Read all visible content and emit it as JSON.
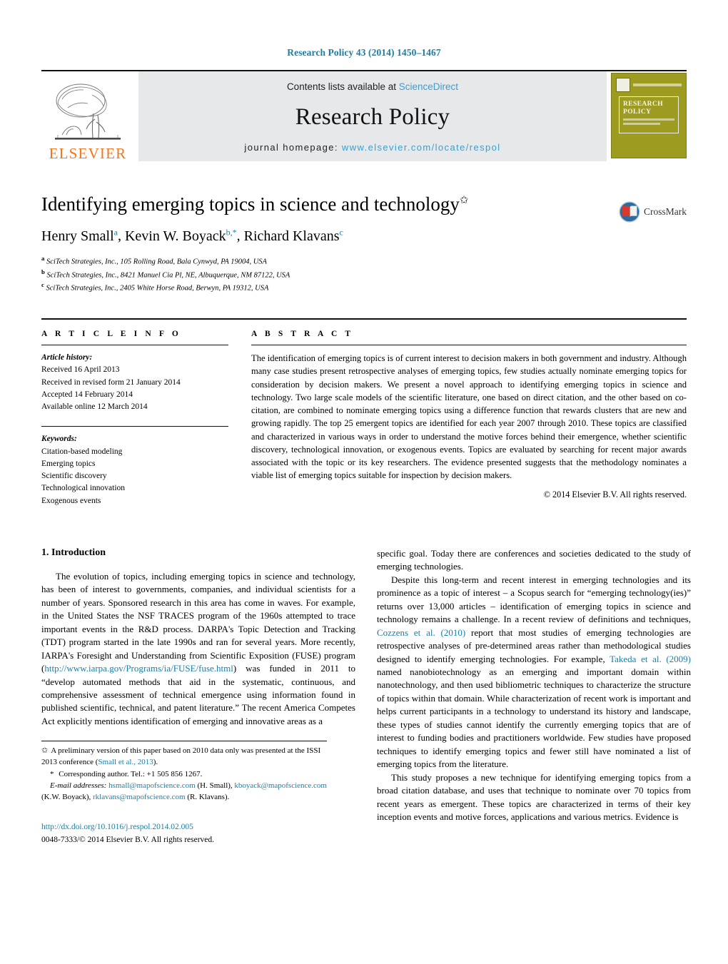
{
  "running_head": "Research Policy 43 (2014) 1450–1467",
  "masthead": {
    "contents_prefix": "Contents lists available at ",
    "sciencedirect": "ScienceDirect",
    "journal_name": "Research Policy",
    "homepage_prefix": "journal homepage: ",
    "homepage_url": "www.elsevier.com/locate/respol",
    "elsevier_wordmark": "ELSEVIER",
    "cover_title": "RESEARCH POLICY",
    "accent_link": "#3a9fd0",
    "elsevier_orange": "#F3761B",
    "cover_olive": "#9d9c21"
  },
  "article": {
    "title": "Identifying emerging topics in science and technology",
    "title_symbol": "✩",
    "authors": "Henry Small, Kevin W. Boyack, Richard Klavans",
    "author_list": [
      {
        "name": "Henry Small",
        "sup": "a"
      },
      {
        "name": "Kevin W. Boyack",
        "sup": "b,*"
      },
      {
        "name": "Richard Klavans",
        "sup": "c"
      }
    ],
    "affiliations": [
      {
        "sup": "a",
        "text": "SciTech Strategies, Inc., 105 Rolling Road, Bala Cynwyd, PA 19004, USA"
      },
      {
        "sup": "b",
        "text": "SciTech Strategies, Inc., 8421 Manuel Cia Pl, NE, Albuquerque, NM 87122, USA"
      },
      {
        "sup": "c",
        "text": "SciTech Strategies, Inc., 2405 White Horse Road, Berwyn, PA 19312, USA"
      }
    ],
    "crossmark_label": "CrossMark"
  },
  "info": {
    "heading": "A R T I C L E   I N F O",
    "history_label": "Article history:",
    "history": [
      "Received 16 April 2013",
      "Received in revised form 21 January 2014",
      "Accepted 14 February 2014",
      "Available online 12 March 2014"
    ],
    "keywords_label": "Keywords:",
    "keywords": [
      "Citation-based modeling",
      "Emerging topics",
      "Scientific discovery",
      "Technological innovation",
      "Exogenous events"
    ]
  },
  "abstract": {
    "heading": "A B S T R A C T",
    "text": "The identification of emerging topics is of current interest to decision makers in both government and industry. Although many case studies present retrospective analyses of emerging topics, few studies actually nominate emerging topics for consideration by decision makers. We present a novel approach to identifying emerging topics in science and technology. Two large scale models of the scientific literature, one based on direct citation, and the other based on co-citation, are combined to nominate emerging topics using a difference function that rewards clusters that are new and growing rapidly. The top 25 emergent topics are identified for each year 2007 through 2010. These topics are classified and characterized in various ways in order to understand the motive forces behind their emergence, whether scientific discovery, technological innovation, or exogenous events. Topics are evaluated by searching for recent major awards associated with the topic or its key researchers. The evidence presented suggests that the methodology nominates a viable list of emerging topics suitable for inspection by decision makers.",
    "copyright": "© 2014 Elsevier B.V. All rights reserved."
  },
  "body": {
    "section_number_title": "1.  Introduction",
    "left_para_1_a": "The evolution of topics, including emerging topics in science and technology, has been of interest to governments, companies, and individual scientists for a number of years. Sponsored research in this area has come in waves. For example, in the United States the NSF TRACES program of the 1960s attempted to trace important events in the R&D process. DARPA's Topic Detection and Tracking (TDT) program started in the late 1990s and ran for several years. More recently, IARPA's Foresight and Understanding from Scientific Exposition (FUSE) program (",
    "fuse_url": "http://www.iarpa.gov/Programs/ia/FUSE/fuse.html",
    "left_para_1_b": ") was funded in 2011 to “develop automated methods that aid in the systematic, continuous, and comprehensive assessment of technical emergence using information found in published scientific, technical, and patent literature.” The recent America Competes Act explicitly mentions identification of emerging and innovative areas as a",
    "right_para_1_cont": "specific goal. Today there are conferences and societies dedicated to the study of emerging technologies.",
    "right_para_2_a": "Despite this long-term and recent interest in emerging technologies and its prominence as a topic of interest – a Scopus search for “emerging technology(ies)” returns over 13,000 articles – identification of emerging topics in science and technology remains a challenge. In a recent review of definitions and techniques, ",
    "ref_cozzens": "Cozzens et al. (2010)",
    "right_para_2_b": " report that most studies of emerging technologies are retrospective analyses of pre-determined areas rather than methodological studies designed to identify emerging technologies. For example, ",
    "ref_takeda": "Takeda et al. (2009)",
    "right_para_2_c": " named nanobiotechnology as an emerging and important domain within nanotechnology, and then used bibliometric techniques to characterize the structure of topics within that domain. While characterization of recent work is important and helps current participants in a technology to understand its history and landscape, these types of studies cannot identify the currently emerging topics that are of interest to funding bodies and practitioners worldwide. Few studies have proposed techniques to identify emerging topics and fewer still have nominated a list of emerging topics from the literature.",
    "right_para_3": "This study proposes a new technique for identifying emerging topics from a broad citation database, and uses that technique to nominate over 70 topics from recent years as emergent. These topics are characterized in terms of their key inception events and motive forces, applications and various metrics. Evidence is"
  },
  "footnotes": {
    "star_symbol": "✩",
    "star_text_a": "A preliminary version of this paper based on 2010 data only was presented at the ISSI 2013 conference (",
    "star_ref": "Small et al., 2013",
    "star_text_b": ").",
    "corr_symbol": "*",
    "corr_text": "Corresponding author. Tel.: +1 505 856 1267.",
    "email_label": "E-mail addresses:",
    "emails": [
      {
        "address": "hsmall@mapofscience.com",
        "owner": "(H. Small)"
      },
      {
        "address": "kboyack@mapofscience.com",
        "owner": "(K.W. Boyack)"
      },
      {
        "address": "rklavans@mapofscience.com",
        "owner": "(R. Klavans)"
      }
    ]
  },
  "footer": {
    "doi_url": "http://dx.doi.org/10.1016/j.respol.2014.02.005",
    "issn_line": "0048-7333/© 2014 Elsevier B.V. All rights reserved."
  }
}
